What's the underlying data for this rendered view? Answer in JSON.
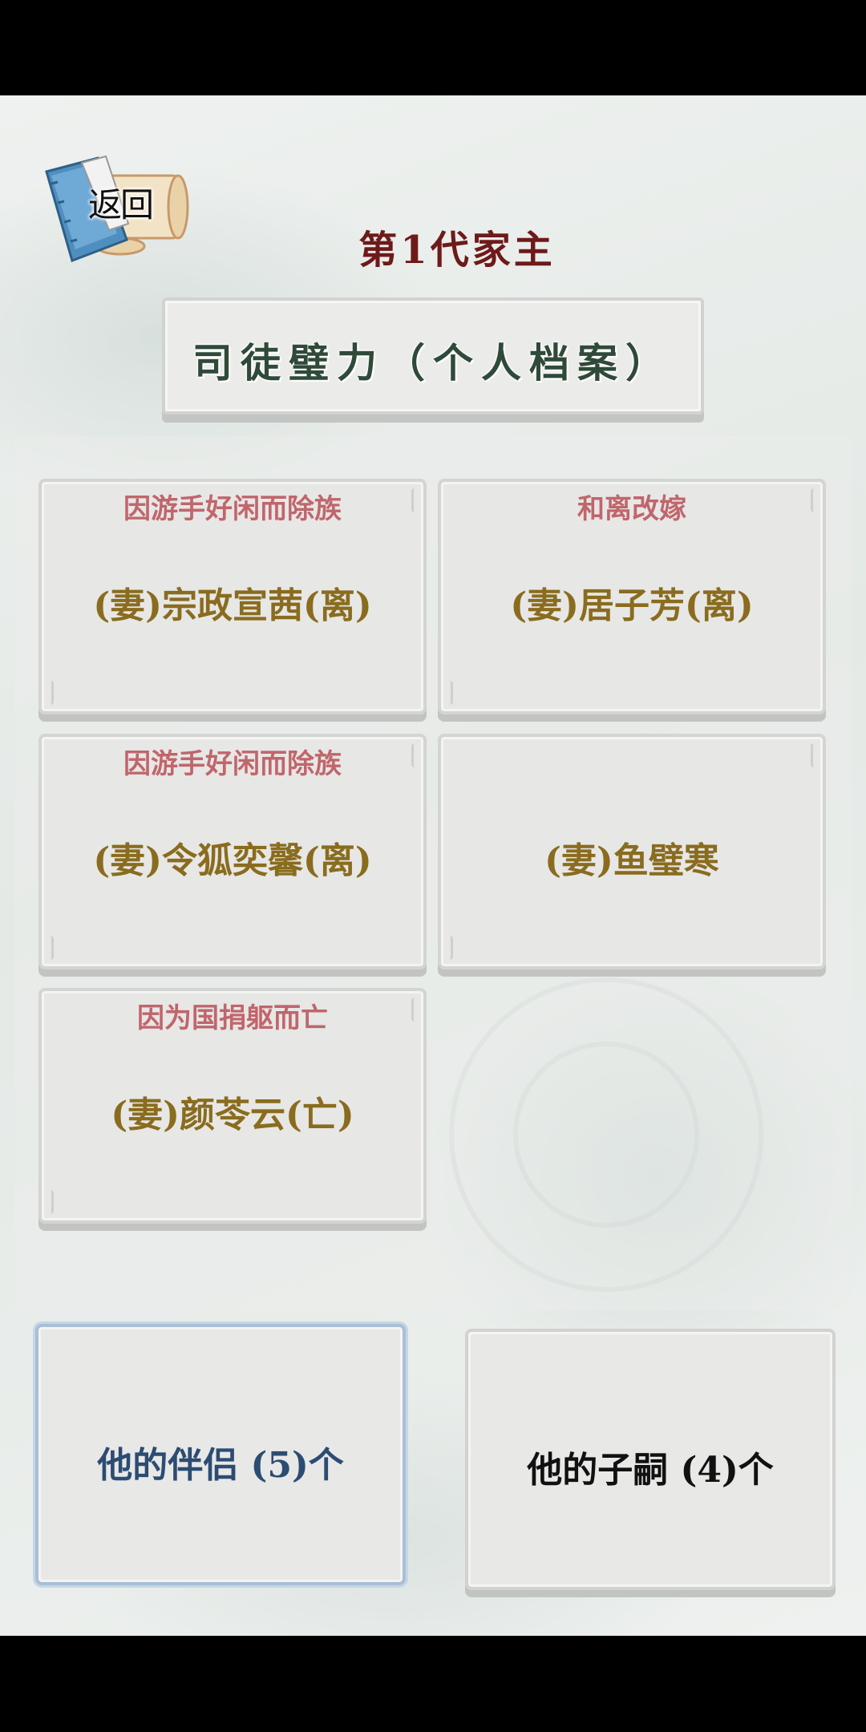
{
  "header": {
    "back_label": "返回",
    "generation_title": "第1代家主",
    "profile_name": "司徒璧力（个人档案）"
  },
  "spouses": [
    {
      "reason": "因游手好闲而除族",
      "name": "(妻)宗政宣茜(离)"
    },
    {
      "reason": "和离改嫁",
      "name": "(妻)居子芳(离)"
    },
    {
      "reason": "因游手好闲而除族",
      "name": "(妻)令狐奕馨(离)"
    },
    {
      "reason": "",
      "name": "(妻)鱼璧寒"
    },
    {
      "reason": "因为国捐躯而亡",
      "name": "(妻)颜苓云(亡)"
    }
  ],
  "tabs": {
    "partners_label": "他的伴侣 (5)个",
    "children_label": "他的子嗣 (4)个",
    "active": "partners"
  },
  "colors": {
    "title": "#6e1a1a",
    "profile_name": "#2f4a38",
    "reason": "#c0666b",
    "person": "#8a6c1e",
    "active_tab": "#2c4c72"
  }
}
